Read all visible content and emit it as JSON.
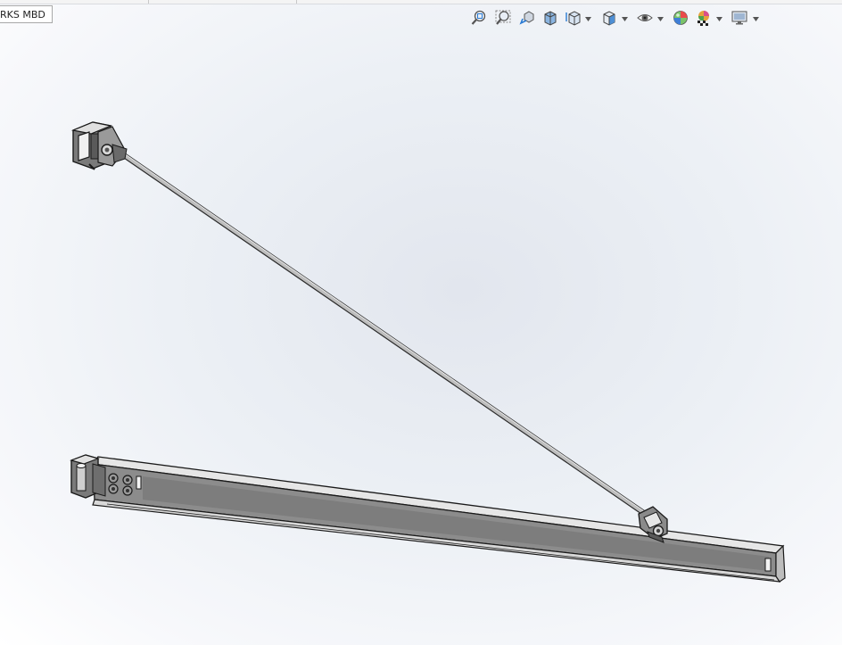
{
  "tab": {
    "label": "RKS MBD"
  },
  "heads_up_toolbar": {
    "items": [
      {
        "icon": "zoom-to-fit-icon"
      },
      {
        "icon": "zoom-to-area-icon"
      },
      {
        "icon": "previous-view-icon"
      },
      {
        "icon": "section-view-icon"
      },
      {
        "icon": "dynamic-annotation-views-icon",
        "has_menu": true
      },
      {
        "icon": "view-orientation-icon",
        "has_menu": true
      },
      {
        "icon": "display-style-icon",
        "has_menu": true
      },
      {
        "icon": "hide-show-items-icon",
        "has_menu": true
      },
      {
        "icon": "edit-appearance-icon"
      },
      {
        "icon": "apply-scene-icon",
        "has_menu": true
      },
      {
        "icon": "view-settings-icon",
        "has_menu": true
      }
    ]
  },
  "model": {
    "name": "jib-crane-assembly",
    "colors": {
      "steel": "#8a8a8a",
      "steel_dark": "#4a4a4a",
      "steel_light": "#e6e6e6",
      "outline": "#1a1a1a"
    }
  }
}
